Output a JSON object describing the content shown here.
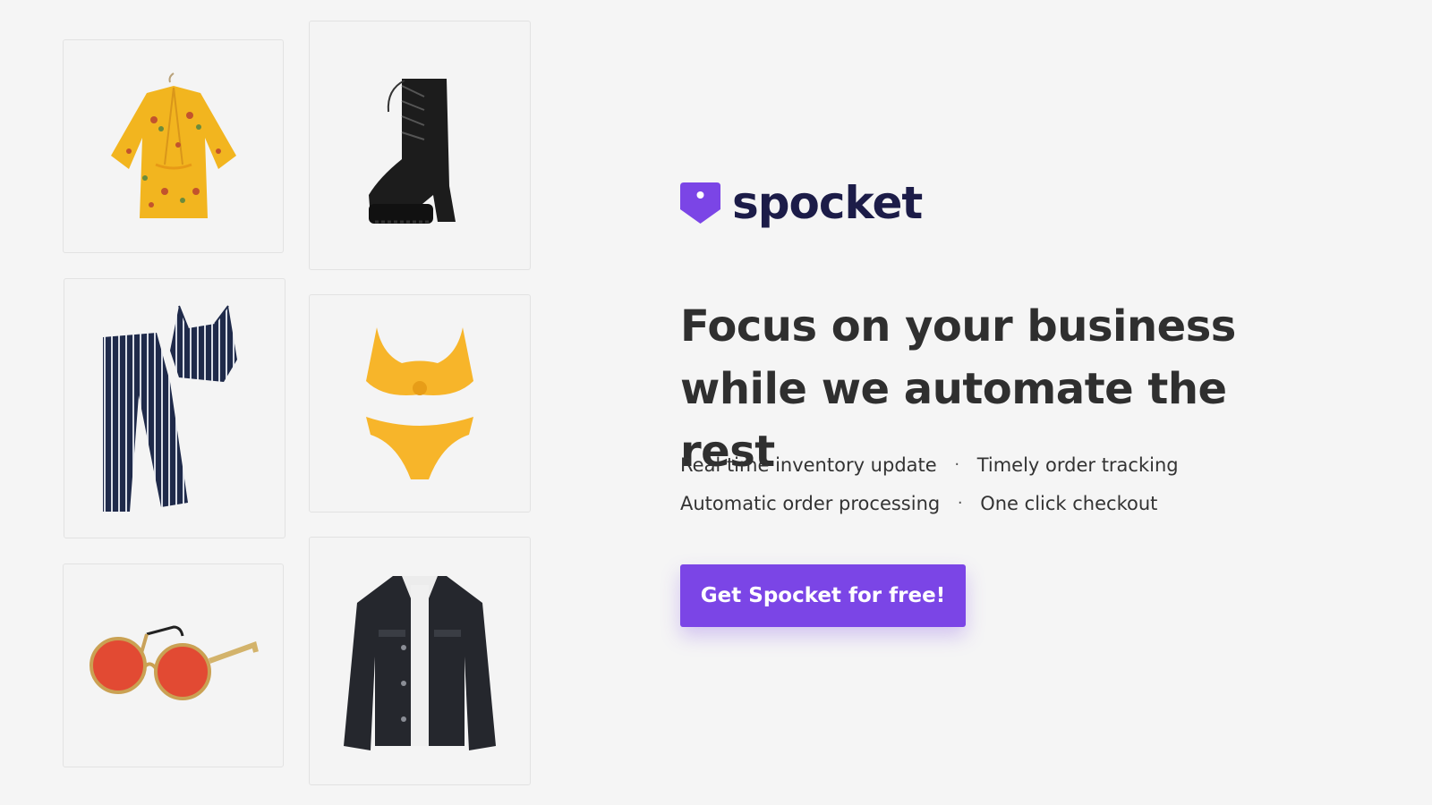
{
  "brand": {
    "name": "spocket",
    "logo_icon": "spocket-tag-icon",
    "accent_color": "#7b45e6"
  },
  "headline": {
    "line1": "Focus on your business",
    "line2": "while we automate the rest"
  },
  "features": [
    "Real time inventory update",
    "Timely order tracking",
    "Automatic order processing",
    "One click checkout"
  ],
  "feature_separator": "·",
  "cta": {
    "label": "Get Spocket for free!"
  },
  "products": [
    {
      "icon": "floral-blouse-icon"
    },
    {
      "icon": "platform-boot-icon"
    },
    {
      "icon": "striped-pajama-set-icon"
    },
    {
      "icon": "yellow-bikini-icon"
    },
    {
      "icon": "round-sunglasses-icon"
    },
    {
      "icon": "denim-jacket-icon"
    }
  ]
}
